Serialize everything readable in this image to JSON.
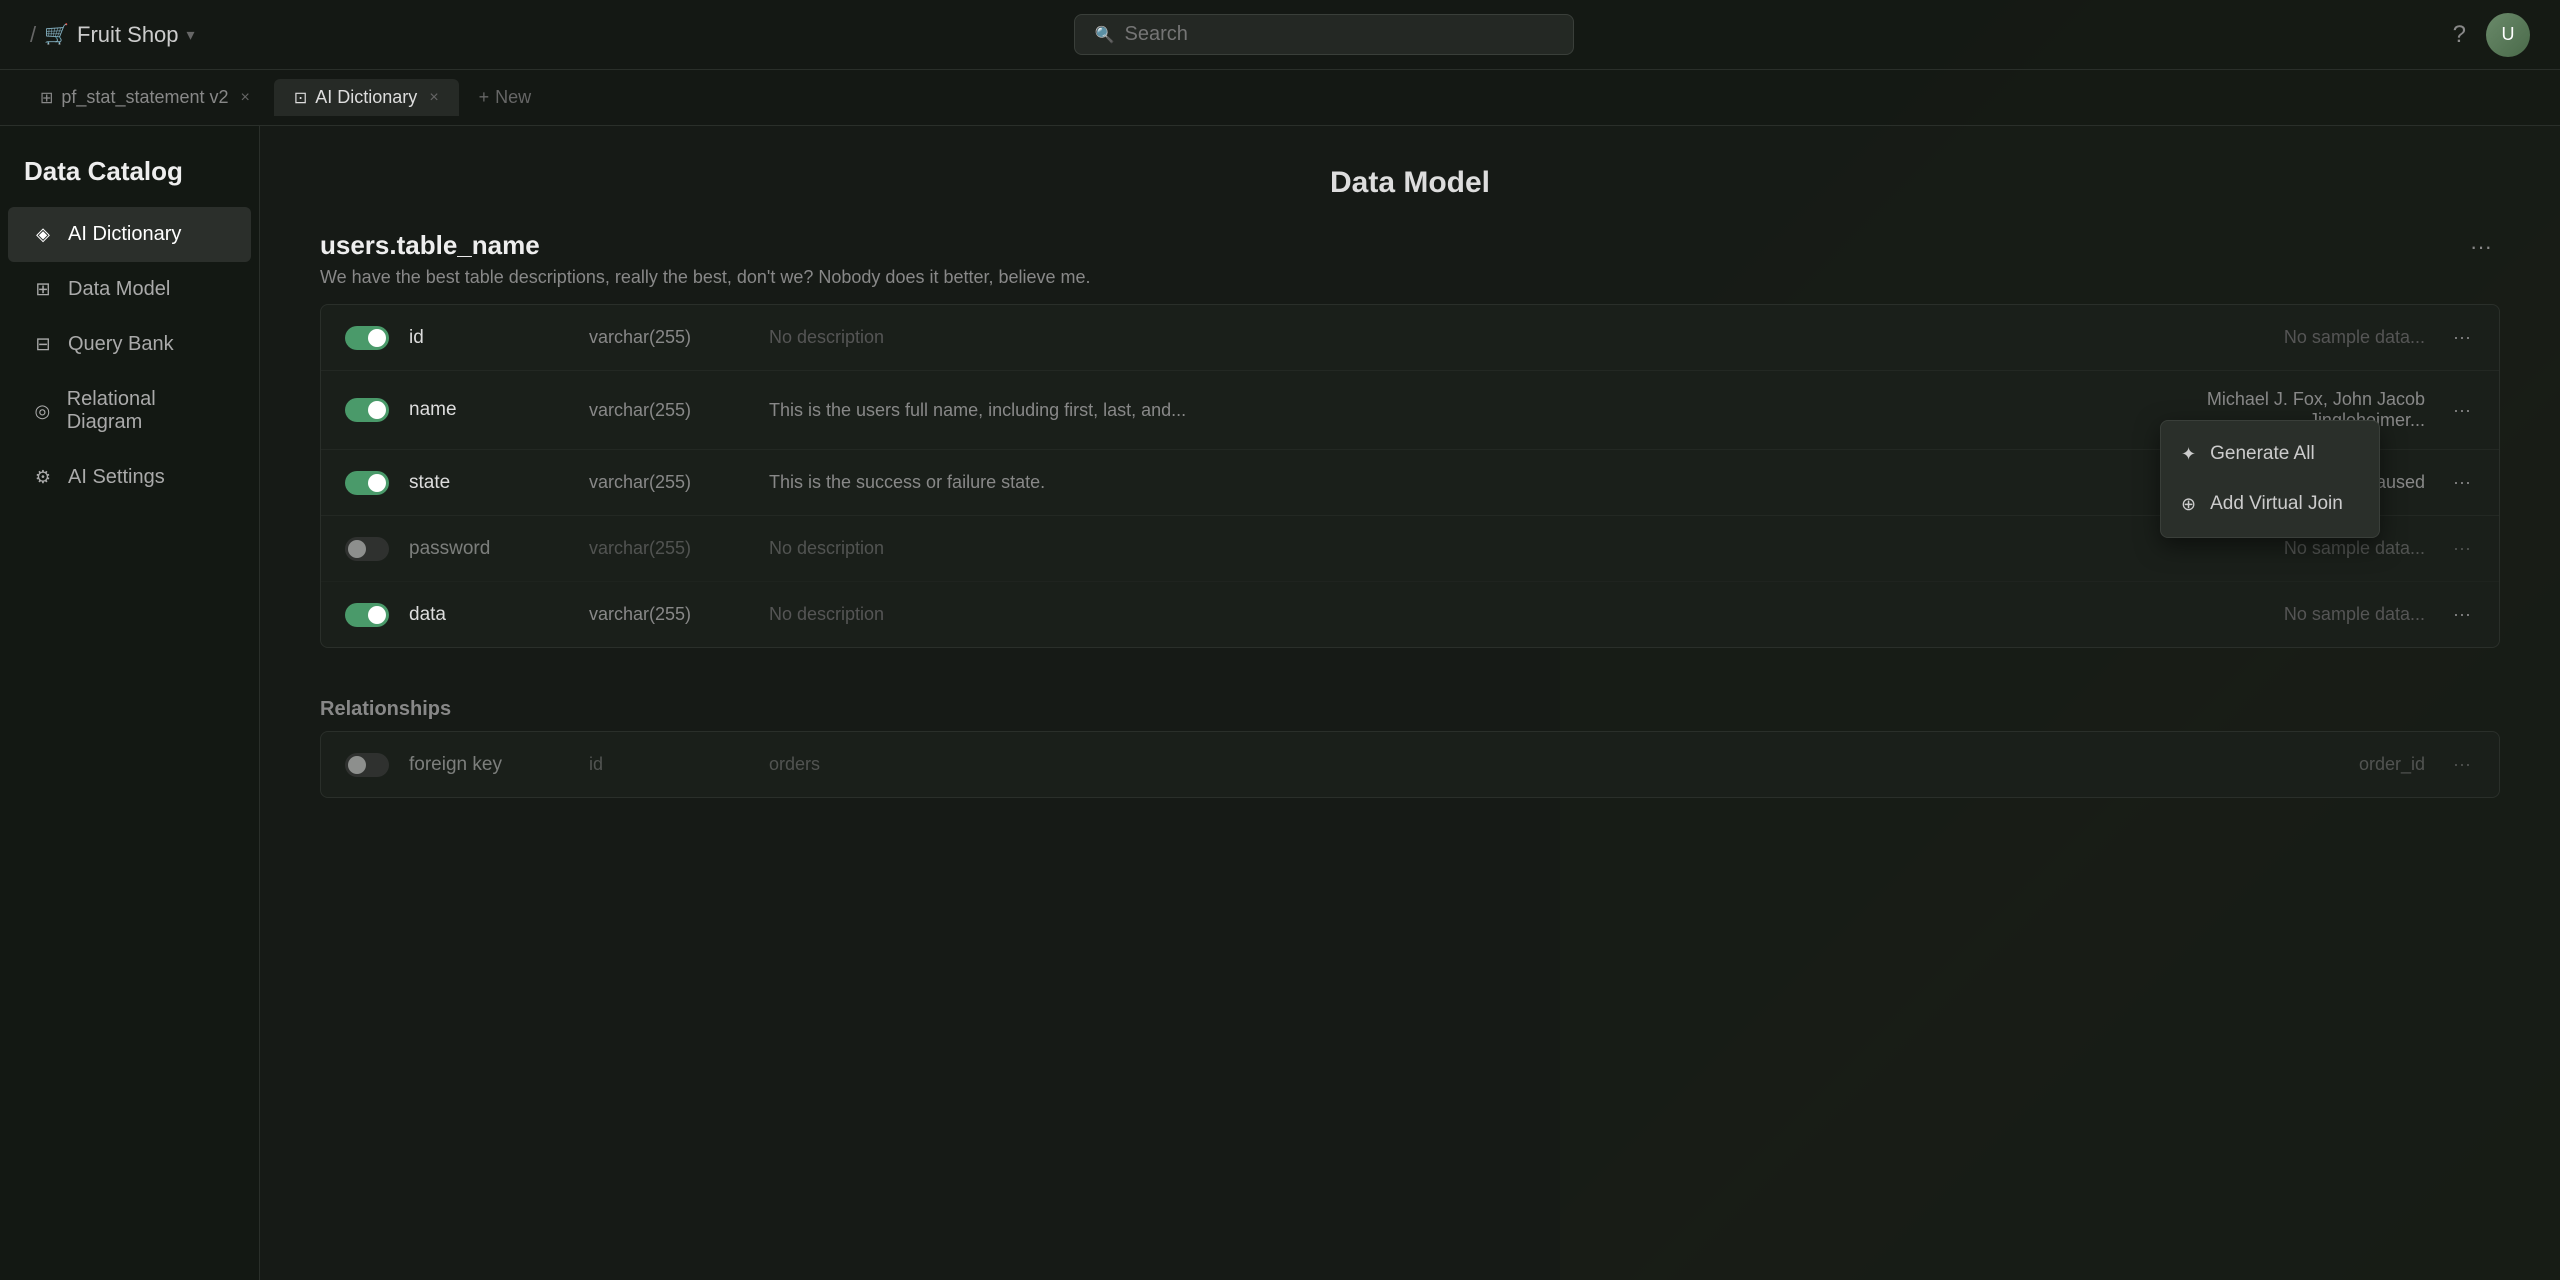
{
  "app": {
    "name": "Fruit Shop",
    "breadcrumb": "/"
  },
  "topbar": {
    "search_placeholder": "Search",
    "search_label": "Search",
    "help_icon": "?",
    "avatar_initials": "U"
  },
  "tabs": [
    {
      "id": "pf_stat",
      "label": "pf_stat_statement v2",
      "icon": "⊞",
      "active": false,
      "closeable": true
    },
    {
      "id": "ai_dictionary",
      "label": "AI Dictionary",
      "icon": "⊡",
      "active": true,
      "closeable": true
    },
    {
      "id": "new",
      "label": "New",
      "icon": "+",
      "active": false,
      "closeable": false
    }
  ],
  "sidebar": {
    "title": "Data Catalog",
    "items": [
      {
        "id": "ai_dictionary",
        "label": "AI Dictionary",
        "icon": "◈",
        "active": true
      },
      {
        "id": "data_model",
        "label": "Data Model",
        "icon": "⊞",
        "active": false
      },
      {
        "id": "query_bank",
        "label": "Query Bank",
        "icon": "⊟",
        "active": false
      },
      {
        "id": "relational_diagram",
        "label": "Relational Diagram",
        "icon": "◎",
        "active": false
      },
      {
        "id": "ai_settings",
        "label": "AI Settings",
        "icon": "⚙",
        "active": false
      }
    ]
  },
  "main": {
    "page_title": "Data Model",
    "table": {
      "name": "users.table_name",
      "description": "We have the best table descriptions, really the best, don't we? Nobody does it better, believe me.",
      "columns": [
        {
          "id": "id",
          "name": "id",
          "type": "varchar(255)",
          "description": "No description",
          "sample": "No sample data...",
          "toggle": "on",
          "dimmed": false
        },
        {
          "id": "name",
          "name": "name",
          "type": "varchar(255)",
          "description": "This is the users full name, including first, last, and...",
          "sample": "Michael J. Fox, John Jacob Jingleheimer...",
          "toggle": "on",
          "dimmed": false
        },
        {
          "id": "state",
          "name": "state",
          "type": "varchar(255)",
          "description": "This is the success or failure state.",
          "sample": "Success, Failure, Paused",
          "toggle": "on",
          "dimmed": false
        },
        {
          "id": "password",
          "name": "password",
          "type": "varchar(255)",
          "description": "No description",
          "sample": "No sample data...",
          "toggle": "off",
          "dimmed": true
        },
        {
          "id": "data",
          "name": "data",
          "type": "varchar(255)",
          "description": "No description",
          "sample": "No sample data...",
          "toggle": "on",
          "dimmed": false
        }
      ]
    },
    "relationships": {
      "label": "Relationships",
      "columns": [
        {
          "id": "foreign_key",
          "name": "foreign key",
          "type": "id",
          "description": "orders",
          "sample": "order_id",
          "toggle": "off",
          "dimmed": true
        }
      ]
    }
  },
  "dropdown_menu": {
    "visible": true,
    "items": [
      {
        "id": "generate_all",
        "label": "Generate All",
        "icon": "✦"
      },
      {
        "id": "add_virtual_join",
        "label": "Add Virtual Join",
        "icon": "⊕"
      }
    ]
  },
  "colors": {
    "toggle_on": "#4a9a6a",
    "toggle_off": "#444444",
    "bg_primary": "#161a16",
    "bg_sidebar": "#141814",
    "accent": "#4a9a6a"
  }
}
